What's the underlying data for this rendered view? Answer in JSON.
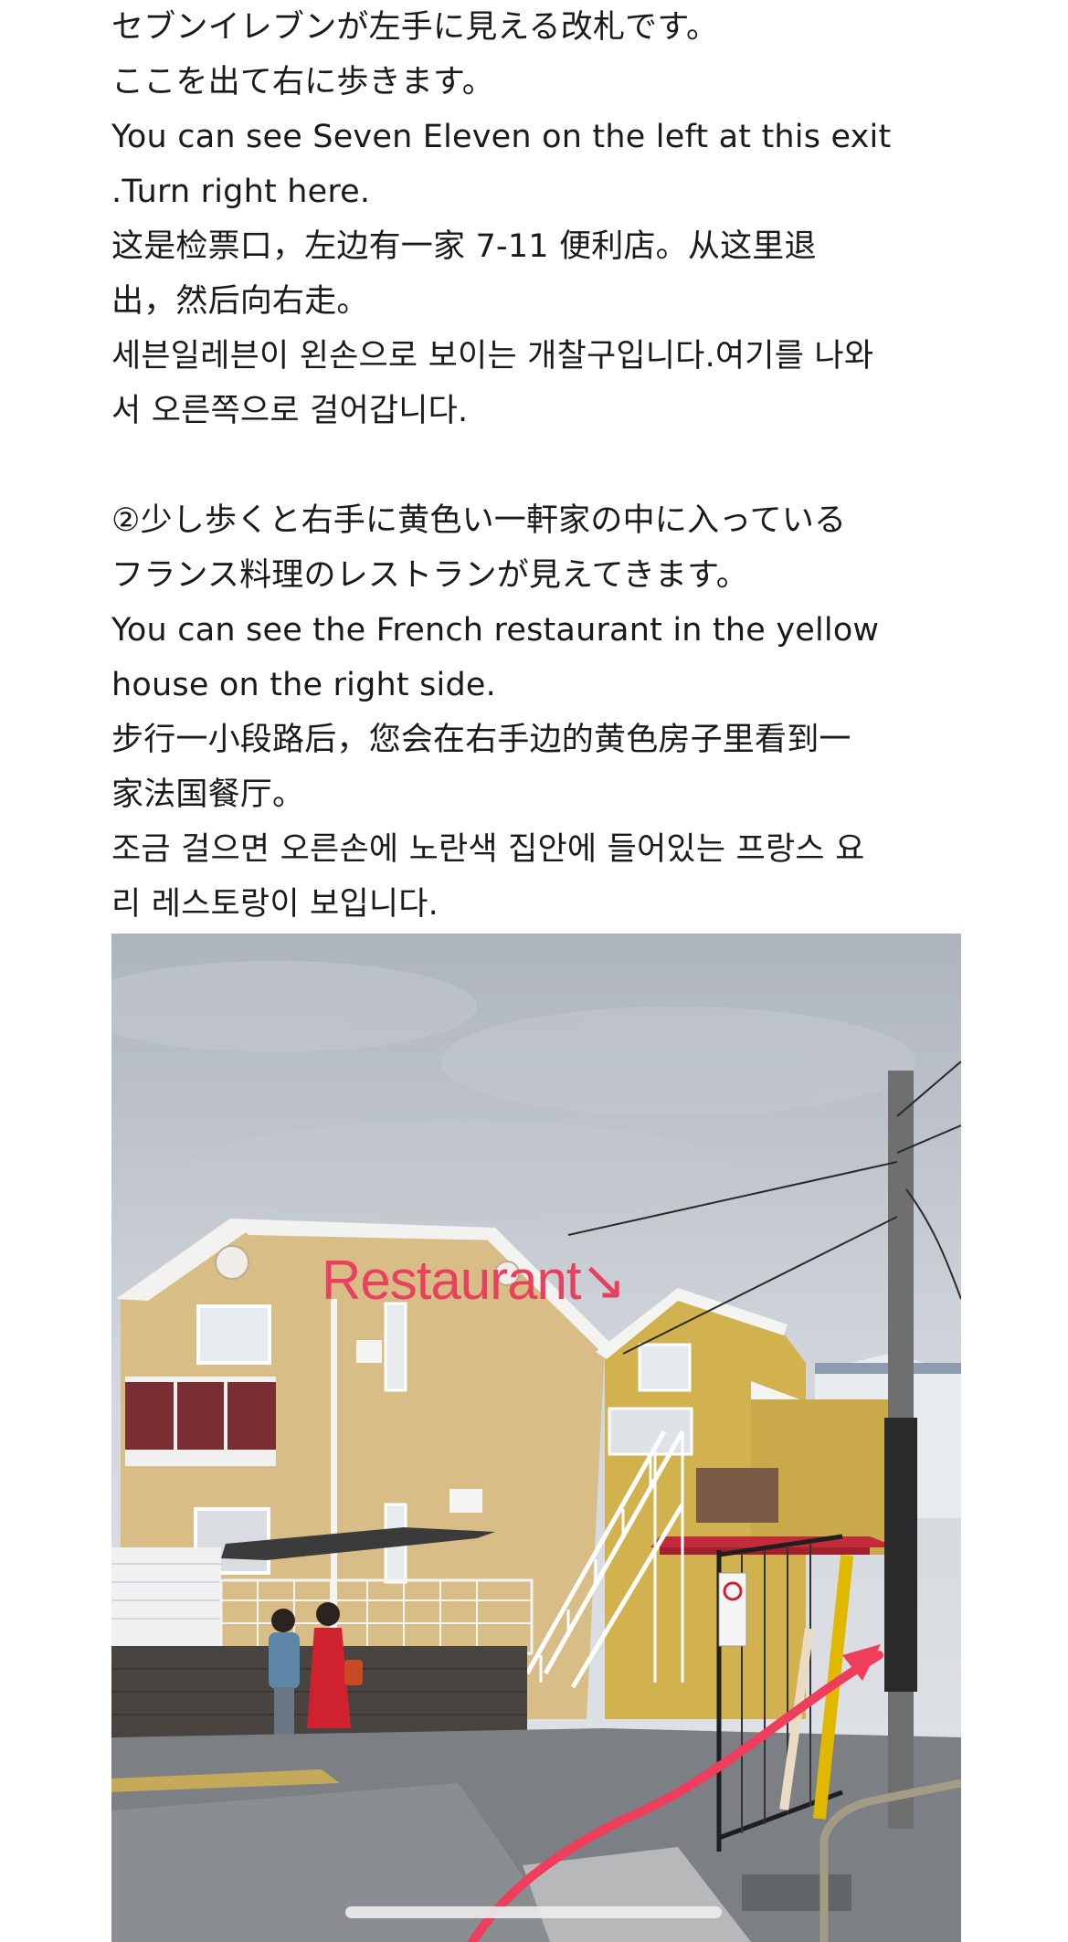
{
  "section1": {
    "lines": [
      "セブンイレブンが左手に見える改札です。",
      "ここを出て右に歩きます。",
      "You can see Seven Eleven on the left at this exit",
      ".Turn right here.",
      "这是检票口，左边有一家 7-11 便利店。从这里退",
      "出，然后向右走。",
      "세븐일레븐이 왼손으로 보이는 개찰구입니다.여기를 나와",
      "서 오른쪽으로 걸어갑니다."
    ]
  },
  "section2": {
    "lines": [
      "②少し歩くと右手に黄色い一軒家の中に入っている",
      "フランス料理のレストランが見えてきます。",
      "You can see the French restaurant in the yellow",
      "house on the right side.",
      "步行一小段路后，您会在右手边的黄色房子里看到一",
      "家法国餐厅。",
      "조금 걸으면 오른손에 노란색 집안에 들어있는 프랑스 요",
      "리 레스토랑이 보입니다."
    ]
  },
  "photo": {
    "annotation": "Restaurant↘",
    "annotation_color": "#e8415f",
    "arrow_color": "#ef3e5c"
  }
}
